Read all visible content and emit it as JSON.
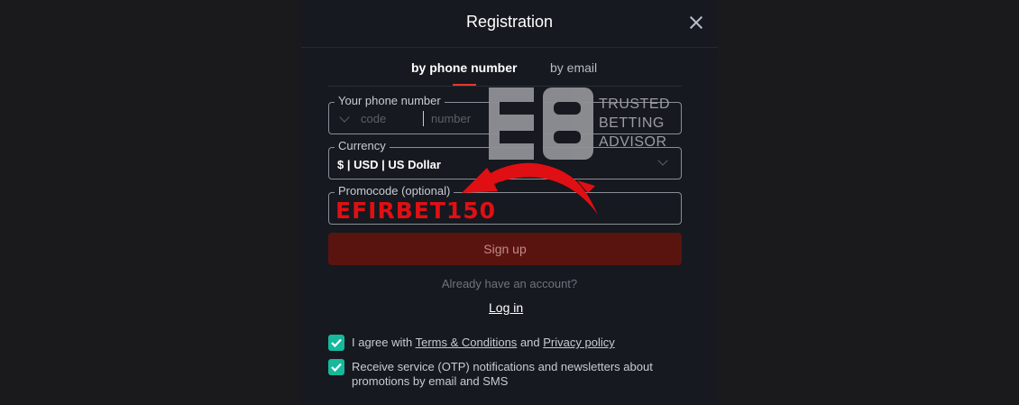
{
  "header": {
    "title": "Registration"
  },
  "tabs": [
    {
      "label": "by phone number",
      "active": true
    },
    {
      "label": "by email",
      "active": false
    }
  ],
  "phone": {
    "label": "Your phone number",
    "code_placeholder": "code",
    "number_placeholder": "number"
  },
  "currency": {
    "label": "Currency",
    "value": "$ | USD | US Dollar"
  },
  "promo": {
    "label": "Promocode (optional)",
    "value": "EFIRBET150"
  },
  "signup_label": "Sign up",
  "already_text": "Already have an account?",
  "login_label": "Log in",
  "agree": {
    "prefix": "I agree with",
    "terms": "Terms & Conditions",
    "and": "and",
    "privacy": "Privacy policy"
  },
  "newsletter": {
    "line1": "Receive service (OTP) notifications and newsletters about",
    "line2": "promotions by email and SMS"
  },
  "watermark": {
    "line1": "TRUSTED",
    "line2": "BETTING",
    "line3": "ADVISOR"
  },
  "colors": {
    "accent": "#e7372e",
    "checkbox": "#17b89c",
    "signup_bg": "#5a1410",
    "promo_text": "#e00f14"
  }
}
